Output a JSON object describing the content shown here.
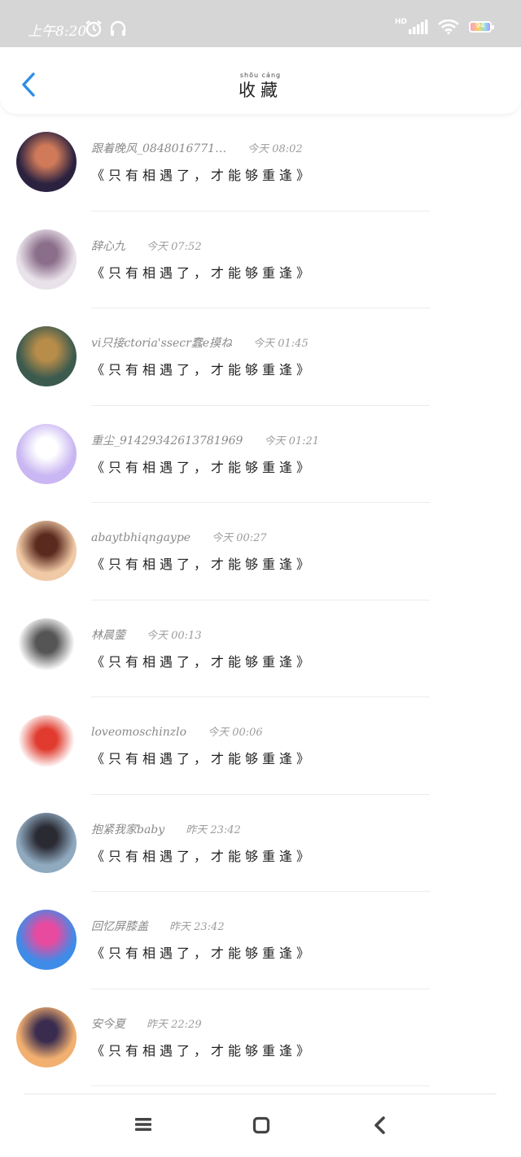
{
  "status_bar": {
    "time": "上午8:20",
    "network": "HD",
    "battery": "94"
  },
  "header": {
    "title_pinyin": "shōu cáng",
    "title": "收藏",
    "back_icon": "chevron-left-icon"
  },
  "favorites": [
    {
      "name": "跟着晚风_0848016771…",
      "time": "今天 08:02",
      "message": "《只有相遇了，才能够重逢》",
      "avatar_colors": [
        "#2b2240",
        "#d07a5a"
      ]
    },
    {
      "name": "辞心九",
      "time": "今天 07:52",
      "message": "《只有相遇了，才能够重逢》",
      "avatar_colors": [
        "#e9e2ea",
        "#8b6e8a"
      ]
    },
    {
      "name": "vi只接ctoria'ssecr蠢e摸ね",
      "time": "今天 01:45",
      "message": "《只有相遇了，才能够重逢》",
      "avatar_colors": [
        "#3c5a4e",
        "#b88d4a"
      ]
    },
    {
      "name": "重尘_91429342613781969",
      "time": "今天 01:21",
      "message": "《只有相遇了，才能够重逢》",
      "avatar_colors": [
        "#c9b6f2",
        "#ffffff"
      ]
    },
    {
      "name": "abaytbhiqngaype",
      "time": "今天 00:27",
      "message": "《只有相遇了，才能够重逢》",
      "avatar_colors": [
        "#f0c9a6",
        "#5a2a1e"
      ]
    },
    {
      "name": "林晨蓥",
      "time": "今天 00:13",
      "message": "《只有相遇了，才能够重逢》",
      "avatar_colors": [
        "#ffffff",
        "#555555"
      ]
    },
    {
      "name": "loveomoschinzlo",
      "time": "今天 00:06",
      "message": "《只有相遇了，才能够重逢》",
      "avatar_colors": [
        "#ffffff",
        "#e03b2e"
      ]
    },
    {
      "name": "抱紧我家baby",
      "time": "昨天 23:42",
      "message": "《只有相遇了，才能够重逢》",
      "avatar_colors": [
        "#8fa9bf",
        "#2a2a33"
      ]
    },
    {
      "name": "回忆屏膝盖",
      "time": "昨天 23:42",
      "message": "《只有相遇了，才能够重逢》",
      "avatar_colors": [
        "#3f8be8",
        "#e84aa0"
      ]
    },
    {
      "name": "安今夏",
      "time": "昨天 22:29",
      "message": "《只有相遇了，才能够重逢》",
      "avatar_colors": [
        "#f2b070",
        "#3a2c4e"
      ]
    }
  ],
  "system_nav": {
    "menu_icon": "menu-icon",
    "home_icon": "home-icon",
    "back_icon": "back-icon"
  }
}
